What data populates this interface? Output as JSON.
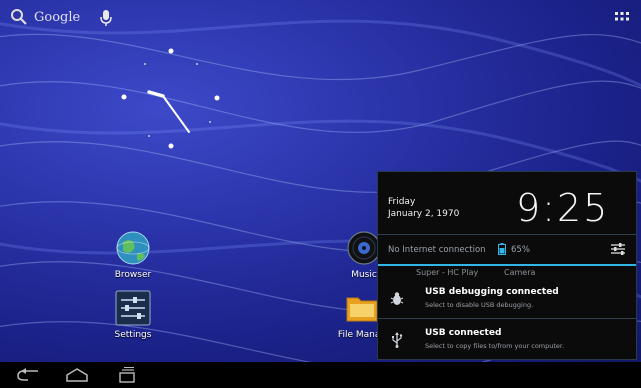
{
  "search": {
    "label": "Google",
    "icon": "search-icon"
  },
  "mic": {
    "icon": "microphone-icon"
  },
  "apps": {
    "icon": "all-apps-grid-icon"
  },
  "clock_widget": {
    "icon": "analog-clock-icon"
  },
  "home_icons": [
    {
      "label": "Browser",
      "icon": "globe-icon"
    },
    {
      "label": "Settings",
      "icon": "settings-sliders-icon"
    },
    {
      "label": "Music",
      "icon": "music-disc-icon"
    },
    {
      "label": "File Manag",
      "icon": "folder-icon"
    }
  ],
  "notification_panel": {
    "day": "Friday",
    "date": "January 2, 1970",
    "time": "9:25",
    "connection_status": "No Internet connection",
    "battery": "65%",
    "carrier": "Super - HC Play",
    "camera": "Camera",
    "notifications": [
      {
        "title": "USB debugging connected",
        "subtitle": "Select to disable USB debugging.",
        "icon": "bug-icon"
      },
      {
        "title": "USB connected",
        "subtitle": "Select to copy files to/from your computer.",
        "icon": "usb-icon"
      }
    ]
  },
  "navbar": {
    "back_icon": "back-icon",
    "home_icon": "home-icon",
    "recents_icon": "recent-apps-icon"
  },
  "colors": {
    "accent": "#33b5e5",
    "wallpaper": "#2a33a8"
  }
}
